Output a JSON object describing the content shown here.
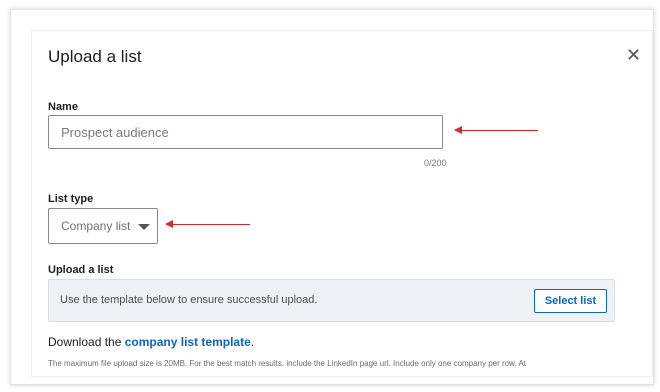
{
  "modal": {
    "title": "Upload a list",
    "close_glyph": "✕"
  },
  "name_field": {
    "label": "Name",
    "placeholder": "Prospect audience",
    "value": "",
    "counter": "0/200"
  },
  "list_type": {
    "label": "List type",
    "selected": "Company list"
  },
  "upload": {
    "label": "Upload a list",
    "hint": "Use the template below to ensure successful upload.",
    "button_label": "Select list"
  },
  "download": {
    "prefix": "Download the ",
    "link_text": "company list template",
    "suffix": "."
  },
  "fineprint": "The maximum file upload size is 20MB. For the best match results, include the LinkedIn page url. Include only one company per row. At",
  "colors": {
    "accent": "#0a66c2",
    "annotation_arrow": "#d8282c",
    "upload_box_bg": "#eef2f6"
  },
  "icons": {
    "close": "close-icon",
    "dropdown": "chevron-down-icon",
    "annotation": "red-arrow-icon"
  }
}
